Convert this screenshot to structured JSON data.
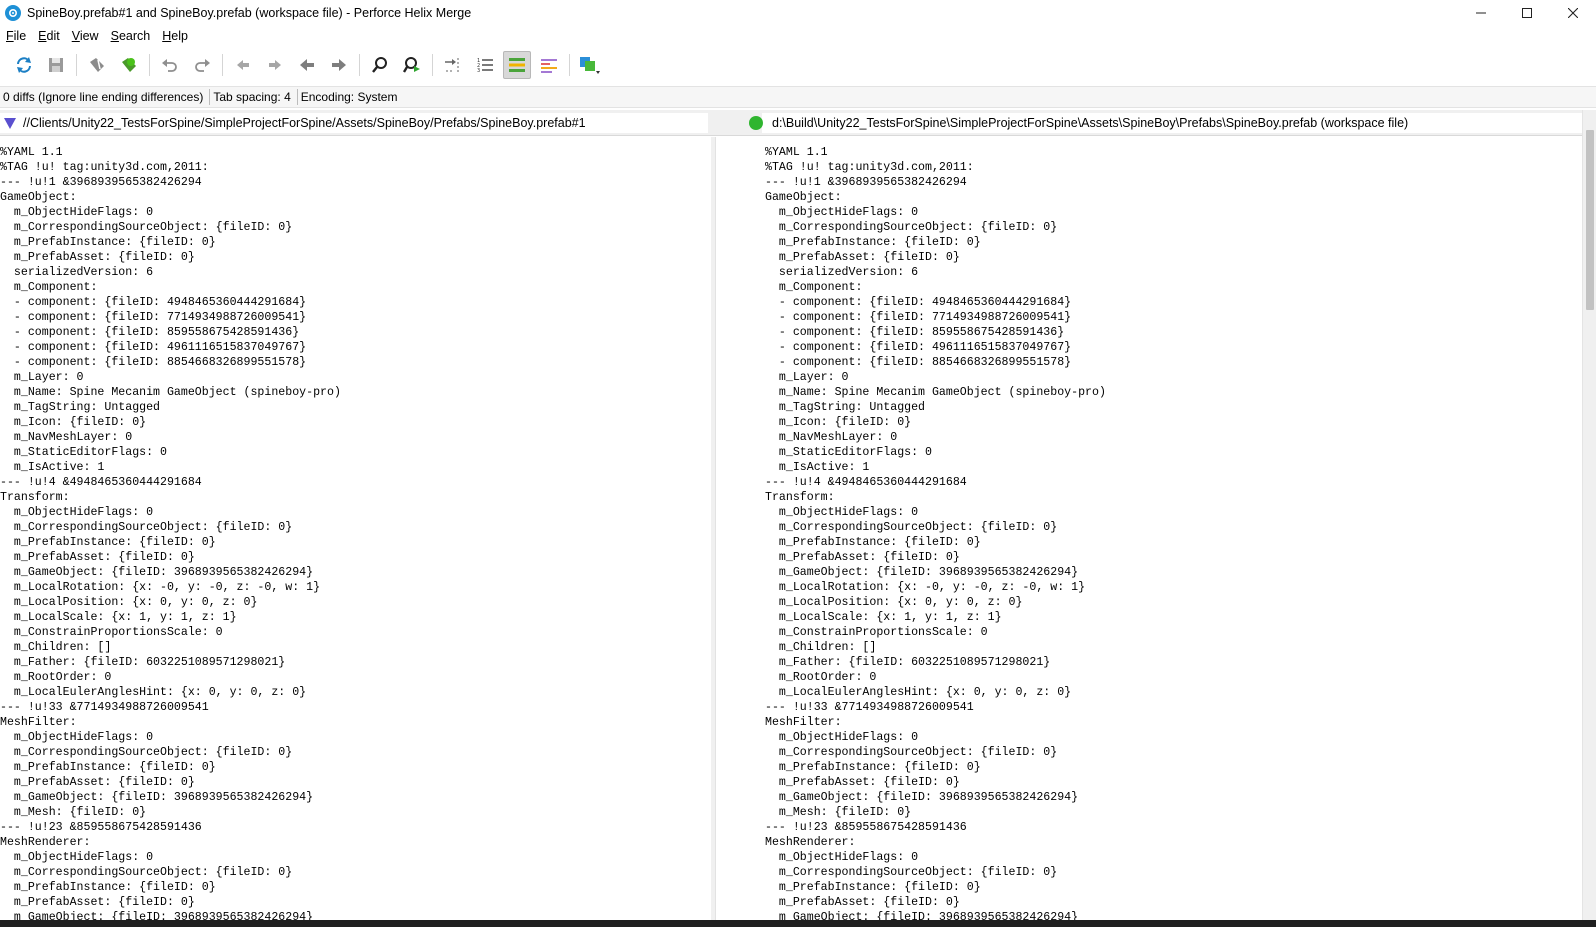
{
  "window": {
    "title": "SpineBoy.prefab#1 and SpineBoy.prefab (workspace file) - Perforce Helix Merge"
  },
  "menu": [
    {
      "label": "File",
      "underline": "F",
      "rest": "ile"
    },
    {
      "label": "Edit",
      "underline": "E",
      "rest": "dit"
    },
    {
      "label": "View",
      "underline": "V",
      "rest": "iew"
    },
    {
      "label": "Search",
      "underline": "S",
      "rest": "earch"
    },
    {
      "label": "Help",
      "underline": "H",
      "rest": "elp"
    }
  ],
  "toolbar": {
    "buttons": [
      "refresh-icon",
      "save-icon",
      "mark-icon",
      "accept-icon",
      "undo-icon",
      "redo-icon",
      "first-diff-icon",
      "next-diff-icon",
      "prev-arrow-icon",
      "next-arrow-icon",
      "find-icon",
      "find-next-icon",
      "goto-line-icon",
      "line-numbers-icon",
      "ignore-whitespace-icon",
      "show-diffs-icon",
      "compare-mode-icon"
    ],
    "active": "ignore-whitespace-icon"
  },
  "status": {
    "diffs": "0 diffs (Ignore line ending differences)",
    "tab_spacing": "Tab spacing: 4",
    "encoding": "Encoding: System"
  },
  "left_path": "//Clients/Unity22_TestsForSpine/SimpleProjectForSpine/Assets/SpineBoy/Prefabs/SpineBoy.prefab#1",
  "right_path": "d:\\Build\\Unity22_TestsForSpine\\SimpleProjectForSpine\\Assets\\SpineBoy\\Prefabs\\SpineBoy.prefab (workspace file)",
  "colors": {
    "left_marker": "#5a4fcf",
    "right_marker": "#2fb52f",
    "app_icon": "#1e90d6"
  },
  "lines": [
    "%YAML 1.1",
    "%TAG !u! tag:unity3d.com,2011:",
    "--- !u!1 &3968939565382426294",
    "GameObject:",
    "  m_ObjectHideFlags: 0",
    "  m_CorrespondingSourceObject: {fileID: 0}",
    "  m_PrefabInstance: {fileID: 0}",
    "  m_PrefabAsset: {fileID: 0}",
    "  serializedVersion: 6",
    "  m_Component:",
    "  - component: {fileID: 4948465360444291684}",
    "  - component: {fileID: 7714934988726009541}",
    "  - component: {fileID: 859558675428591436}",
    "  - component: {fileID: 4961116515837049767}",
    "  - component: {fileID: 8854668326899551578}",
    "  m_Layer: 0",
    "  m_Name: Spine Mecanim GameObject (spineboy-pro)",
    "  m_TagString: Untagged",
    "  m_Icon: {fileID: 0}",
    "  m_NavMeshLayer: 0",
    "  m_StaticEditorFlags: 0",
    "  m_IsActive: 1",
    "--- !u!4 &4948465360444291684",
    "Transform:",
    "  m_ObjectHideFlags: 0",
    "  m_CorrespondingSourceObject: {fileID: 0}",
    "  m_PrefabInstance: {fileID: 0}",
    "  m_PrefabAsset: {fileID: 0}",
    "  m_GameObject: {fileID: 3968939565382426294}",
    "  m_LocalRotation: {x: -0, y: -0, z: -0, w: 1}",
    "  m_LocalPosition: {x: 0, y: 0, z: 0}",
    "  m_LocalScale: {x: 1, y: 1, z: 1}",
    "  m_ConstrainProportionsScale: 0",
    "  m_Children: []",
    "  m_Father: {fileID: 6032251089571298021}",
    "  m_RootOrder: 0",
    "  m_LocalEulerAnglesHint: {x: 0, y: 0, z: 0}",
    "--- !u!33 &7714934988726009541",
    "MeshFilter:",
    "  m_ObjectHideFlags: 0",
    "  m_CorrespondingSourceObject: {fileID: 0}",
    "  m_PrefabInstance: {fileID: 0}",
    "  m_PrefabAsset: {fileID: 0}",
    "  m_GameObject: {fileID: 3968939565382426294}",
    "  m_Mesh: {fileID: 0}",
    "--- !u!23 &859558675428591436",
    "MeshRenderer:",
    "  m_ObjectHideFlags: 0",
    "  m_CorrespondingSourceObject: {fileID: 0}",
    "  m_PrefabInstance: {fileID: 0}",
    "  m_PrefabAsset: {fileID: 0}",
    "  m_GameObject: {fileID: 3968939565382426294}"
  ]
}
